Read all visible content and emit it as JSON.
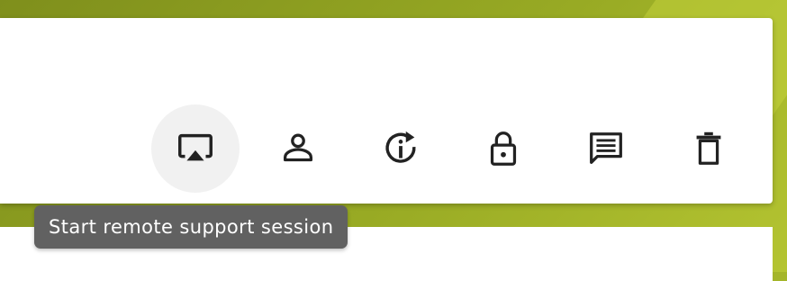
{
  "tooltip": {
    "text": "Start remote support session"
  },
  "toolbar": {
    "buttons": [
      {
        "name": "remote-support",
        "icon": "airplay-icon",
        "active": true
      },
      {
        "name": "user",
        "icon": "person-icon",
        "active": false
      },
      {
        "name": "info-refresh",
        "icon": "info-refresh-icon",
        "active": false
      },
      {
        "name": "lock",
        "icon": "lock-icon",
        "active": false
      },
      {
        "name": "chat",
        "icon": "message-icon",
        "active": false
      },
      {
        "name": "delete",
        "icon": "trash-icon",
        "active": false
      }
    ]
  },
  "colors": {
    "background": "#98aa24",
    "card": "#ffffff",
    "icon": "#222222",
    "tooltip_bg": "#616161",
    "active_button_bg": "#f1f1f1"
  }
}
